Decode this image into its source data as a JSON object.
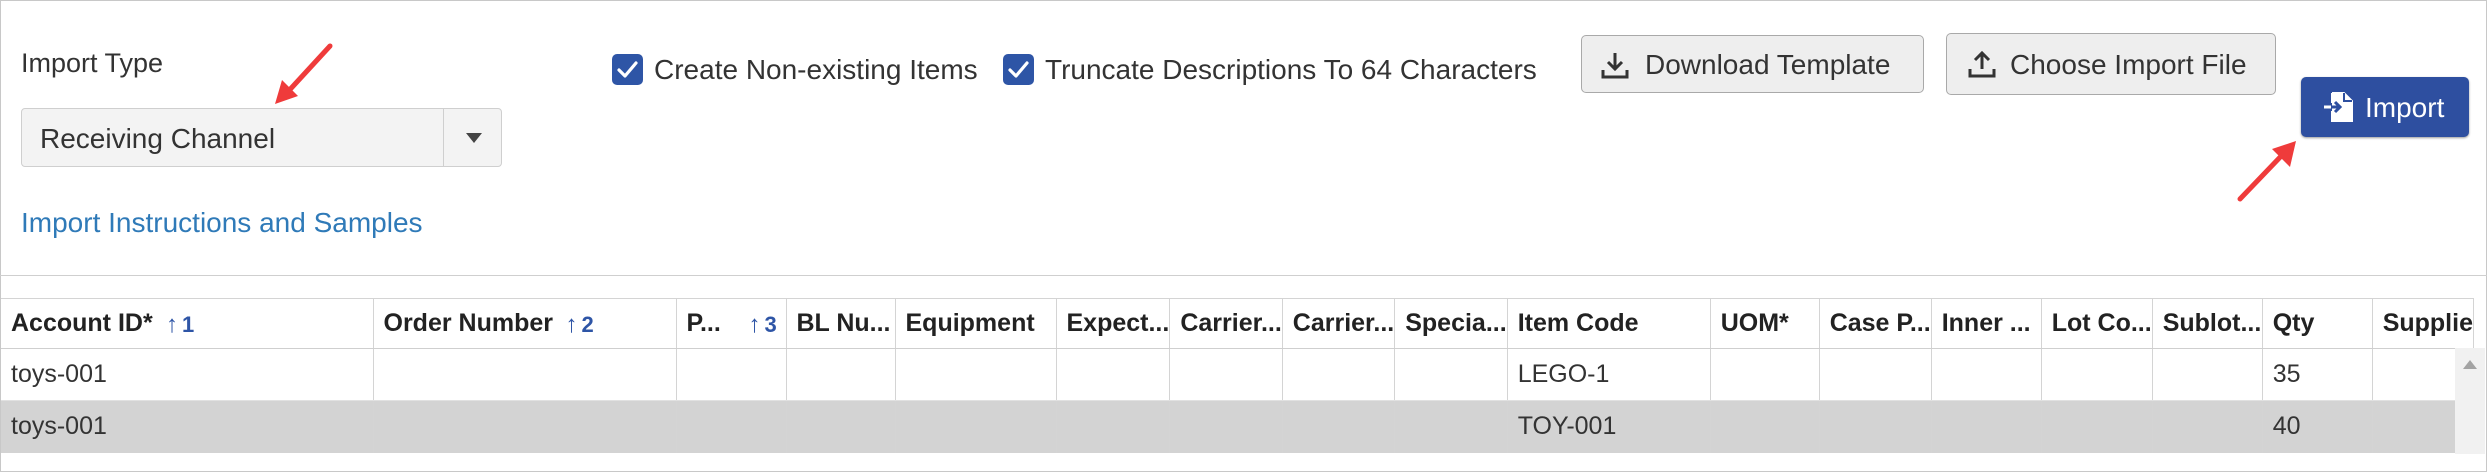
{
  "import_type": {
    "label": "Import Type",
    "selected": "Receiving Channel",
    "instructions_link": "Import Instructions and Samples"
  },
  "options": {
    "create_items": {
      "label": "Create Non-existing Items",
      "checked": true
    },
    "truncate": {
      "label": "Truncate Descriptions To 64 Characters",
      "checked": true
    }
  },
  "buttons": {
    "download_template": "Download Template",
    "choose_file": "Choose Import File",
    "import": "Import"
  },
  "colors": {
    "accent": "#2e55a6",
    "primary_button": "#2e4fa0",
    "link": "#2f7ab8",
    "annotation_arrow": "#ef3b3b",
    "selected_row": "#d3d3d3"
  },
  "table": {
    "columns": [
      {
        "label": "Account ID*",
        "sort_order": "1"
      },
      {
        "label": "Order Number",
        "sort_order": "2"
      },
      {
        "label": "P...",
        "sort_order": "3"
      },
      {
        "label": "BL Nu..."
      },
      {
        "label": "Equipment"
      },
      {
        "label": "Expect..."
      },
      {
        "label": "Carrier..."
      },
      {
        "label": "Carrier..."
      },
      {
        "label": "Specia..."
      },
      {
        "label": "Item Code"
      },
      {
        "label": "UOM*"
      },
      {
        "label": "Case P..."
      },
      {
        "label": "Inner ..."
      },
      {
        "label": "Lot Co..."
      },
      {
        "label": "Sublot..."
      },
      {
        "label": "Qty"
      },
      {
        "label": "Supplie"
      }
    ],
    "rows": [
      {
        "account_id": "toys-001",
        "item_code": "LEGO-1",
        "qty": "35",
        "selected": false
      },
      {
        "account_id": "toys-001",
        "item_code": "TOY-001",
        "qty": "40",
        "selected": true
      }
    ]
  }
}
